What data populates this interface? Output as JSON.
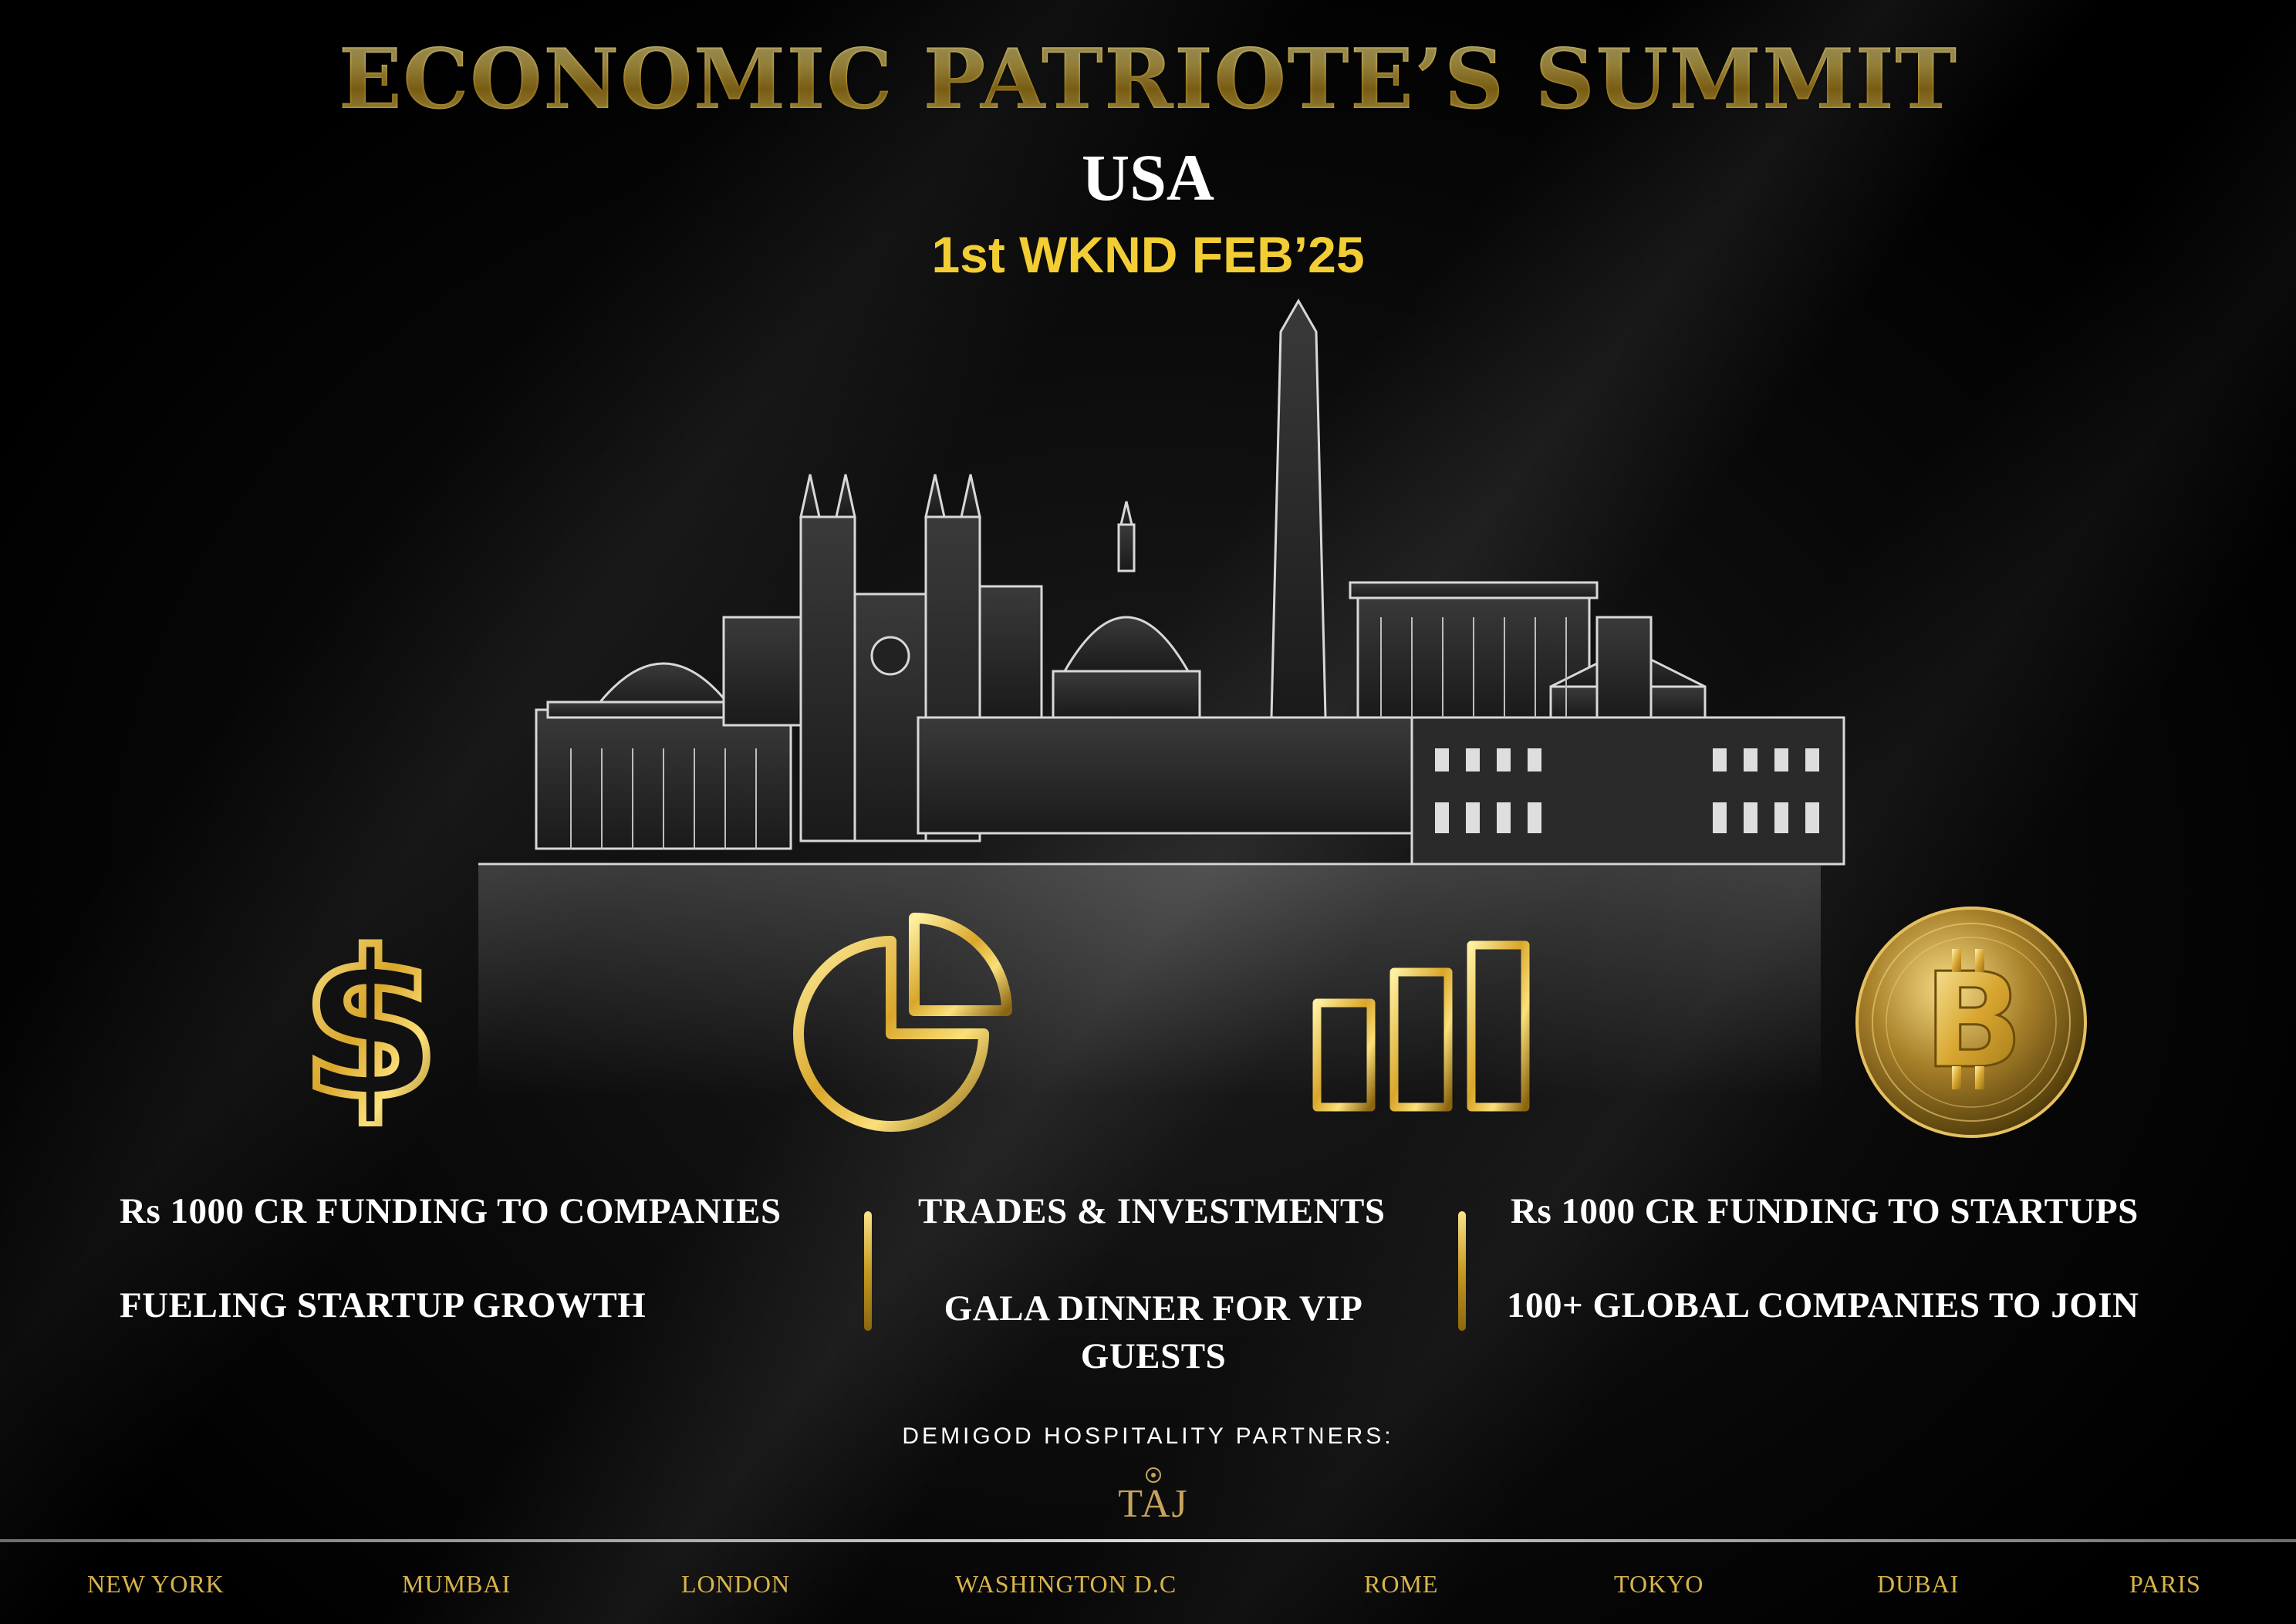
{
  "header": {
    "title": "ECONOMIC PATRIOTE’S SUMMIT",
    "country": "USA",
    "date": "1st WKND FEB’25"
  },
  "colors": {
    "gold": "#e7bd3a",
    "date_yellow": "#f3cd34",
    "text_white": "#ffffff",
    "background": "#000000",
    "city_gold": "#d9b44a"
  },
  "icons": [
    "dollar-icon",
    "pie-chart-icon",
    "bar-chart-icon",
    "bitcoin-icon"
  ],
  "features": {
    "left_top": "Rs 1000 CR FUNDING TO COMPANIES",
    "left_bottom": "FUELING STARTUP GROWTH",
    "middle_top": "TRADES & INVESTMENTS",
    "middle_bottom": "GALA DINNER FOR VIP GUESTS",
    "right_top": "Rs 1000 CR FUNDING TO STARTUPS",
    "right_bottom": "100+ GLOBAL COMPANIES TO JOIN"
  },
  "partners": {
    "label": "DEMIGOD HOSPITALITY PARTNERS:",
    "logo_text": "TAJ"
  },
  "cities": [
    "NEW YORK",
    "MUMBAI",
    "LONDON",
    "WASHINGTON D.C",
    "ROME",
    "TOKYO",
    "DUBAI",
    "PARIS"
  ]
}
